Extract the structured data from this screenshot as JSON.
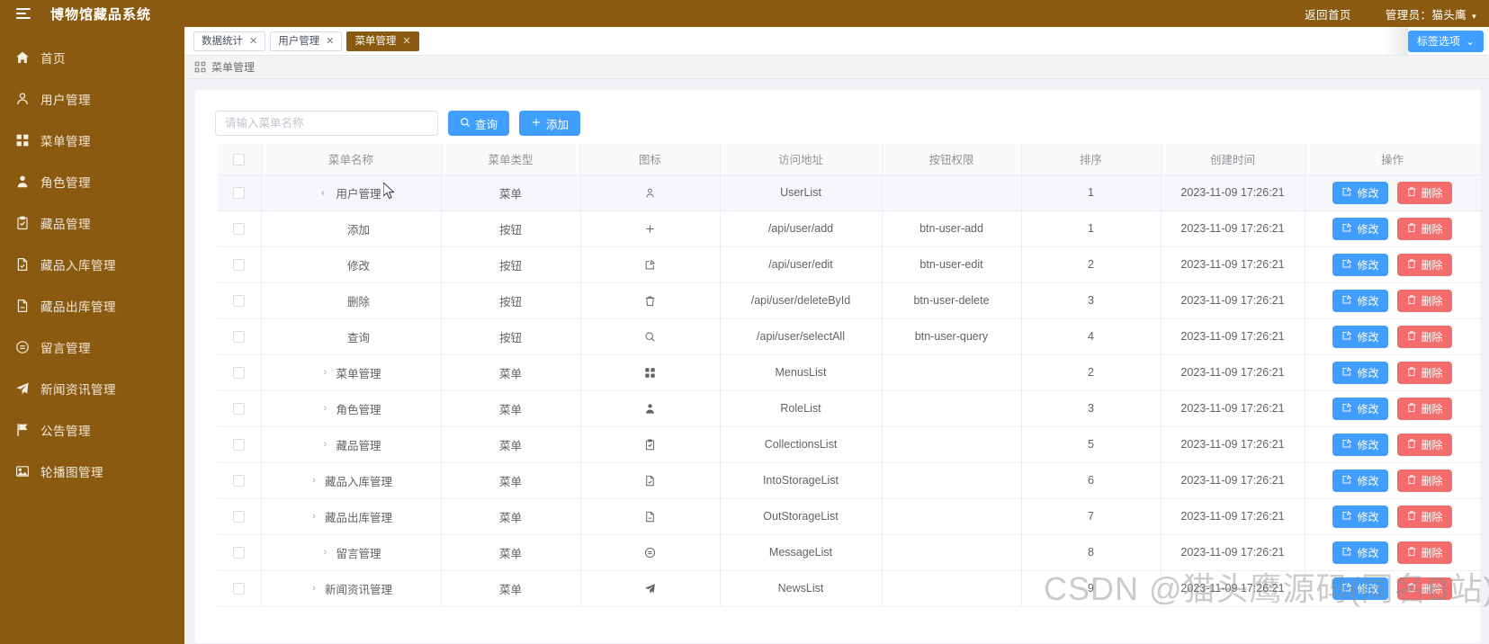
{
  "app": {
    "title": "博物馆藏品系统",
    "brand_color": "#8a5a11",
    "accent_color": "#409eff",
    "danger_color": "#f56c6c"
  },
  "header": {
    "home_link": "返回首页",
    "user_label": "管理员：猫头鹰",
    "caret": "▾"
  },
  "sidebar": {
    "items": [
      {
        "label": "首页",
        "icon": "home-icon"
      },
      {
        "label": "用户管理",
        "icon": "user-icon"
      },
      {
        "label": "菜单管理",
        "icon": "grid-icon"
      },
      {
        "label": "角色管理",
        "icon": "person-solid-icon"
      },
      {
        "label": "藏品管理",
        "icon": "clipboard-check-icon"
      },
      {
        "label": "藏品入库管理",
        "icon": "file-in-icon"
      },
      {
        "label": "藏品出库管理",
        "icon": "file-out-icon"
      },
      {
        "label": "留言管理",
        "icon": "chat-icon"
      },
      {
        "label": "新闻资讯管理",
        "icon": "paper-plane-icon"
      },
      {
        "label": "公告管理",
        "icon": "flag-icon"
      },
      {
        "label": "轮播图管理",
        "icon": "image-icon"
      }
    ]
  },
  "tabs": {
    "items": [
      {
        "label": "数据统计",
        "active": false,
        "close": "✕"
      },
      {
        "label": "用户管理",
        "active": false,
        "close": "✕"
      },
      {
        "label": "菜单管理",
        "active": true,
        "close": "✕"
      }
    ],
    "options_button": "标签选项",
    "options_caret": "⌄"
  },
  "breadcrumb": {
    "text": "菜单管理",
    "icon": "menu-grid-icon"
  },
  "toolbar": {
    "search_placeholder": "请输入菜单名称",
    "search_value": "",
    "query_label": "查询",
    "query_icon": "search-icon",
    "add_label": "添加",
    "add_icon": "plus-icon"
  },
  "table": {
    "columns": [
      "",
      "菜单名称",
      "菜单类型",
      "图标",
      "访问地址",
      "按钮权限",
      "排序",
      "创建时间",
      "操作"
    ],
    "edit_label": "修改",
    "edit_icon": "edit-square-icon",
    "delete_label": "删除",
    "delete_icon": "trash-icon",
    "rows": [
      {
        "name": "用户管理",
        "indent": 0,
        "expanded": true,
        "has_arrow": true,
        "type": "菜单",
        "icon": "user-outline-icon",
        "url": "UserList",
        "perm": "",
        "sort": "1",
        "created": "2023-11-09 17:26:21",
        "highlight": true
      },
      {
        "name": "添加",
        "indent": 0,
        "expanded": false,
        "has_arrow": false,
        "type": "按钮",
        "icon": "plus-icon",
        "url": "/api/user/add",
        "perm": "btn-user-add",
        "sort": "1",
        "created": "2023-11-09 17:26:21",
        "highlight": false
      },
      {
        "name": "修改",
        "indent": 0,
        "expanded": false,
        "has_arrow": false,
        "type": "按钮",
        "icon": "edit-square-icon",
        "url": "/api/user/edit",
        "perm": "btn-user-edit",
        "sort": "2",
        "created": "2023-11-09 17:26:21",
        "highlight": false
      },
      {
        "name": "删除",
        "indent": 0,
        "expanded": false,
        "has_arrow": false,
        "type": "按钮",
        "icon": "trash-icon",
        "url": "/api/user/deleteById",
        "perm": "btn-user-delete",
        "sort": "3",
        "created": "2023-11-09 17:26:21",
        "highlight": false
      },
      {
        "name": "查询",
        "indent": 0,
        "expanded": false,
        "has_arrow": false,
        "type": "按钮",
        "icon": "search-icon",
        "url": "/api/user/selectAll",
        "perm": "btn-user-query",
        "sort": "4",
        "created": "2023-11-09 17:26:21",
        "highlight": false
      },
      {
        "name": "菜单管理",
        "indent": 0,
        "expanded": false,
        "has_arrow": true,
        "type": "菜单",
        "icon": "grid-icon",
        "url": "MenusList",
        "perm": "",
        "sort": "2",
        "created": "2023-11-09 17:26:21",
        "highlight": false
      },
      {
        "name": "角色管理",
        "indent": 0,
        "expanded": false,
        "has_arrow": true,
        "type": "菜单",
        "icon": "person-solid-icon",
        "url": "RoleList",
        "perm": "",
        "sort": "3",
        "created": "2023-11-09 17:26:21",
        "highlight": false
      },
      {
        "name": "藏品管理",
        "indent": 0,
        "expanded": false,
        "has_arrow": true,
        "type": "菜单",
        "icon": "clipboard-check-icon",
        "url": "CollectionsList",
        "perm": "",
        "sort": "5",
        "created": "2023-11-09 17:26:21",
        "highlight": false
      },
      {
        "name": "藏品入库管理",
        "indent": 0,
        "expanded": false,
        "has_arrow": true,
        "type": "菜单",
        "icon": "file-in-icon",
        "url": "IntoStorageList",
        "perm": "",
        "sort": "6",
        "created": "2023-11-09 17:26:21",
        "highlight": false
      },
      {
        "name": "藏品出库管理",
        "indent": 0,
        "expanded": false,
        "has_arrow": true,
        "type": "菜单",
        "icon": "file-out-icon",
        "url": "OutStorageList",
        "perm": "",
        "sort": "7",
        "created": "2023-11-09 17:26:21",
        "highlight": false
      },
      {
        "name": "留言管理",
        "indent": 0,
        "expanded": false,
        "has_arrow": true,
        "type": "菜单",
        "icon": "chat-icon",
        "url": "MessageList",
        "perm": "",
        "sort": "8",
        "created": "2023-11-09 17:26:21",
        "highlight": false
      },
      {
        "name": "新闻资讯管理",
        "indent": 0,
        "expanded": false,
        "has_arrow": true,
        "type": "菜单",
        "icon": "paper-plane-icon",
        "url": "NewsList",
        "perm": "",
        "sort": "9",
        "created": "2023-11-09 17:26:21",
        "highlight": false
      }
    ]
  },
  "watermark": "CSDN @猫头鹰源码(同名B站)"
}
